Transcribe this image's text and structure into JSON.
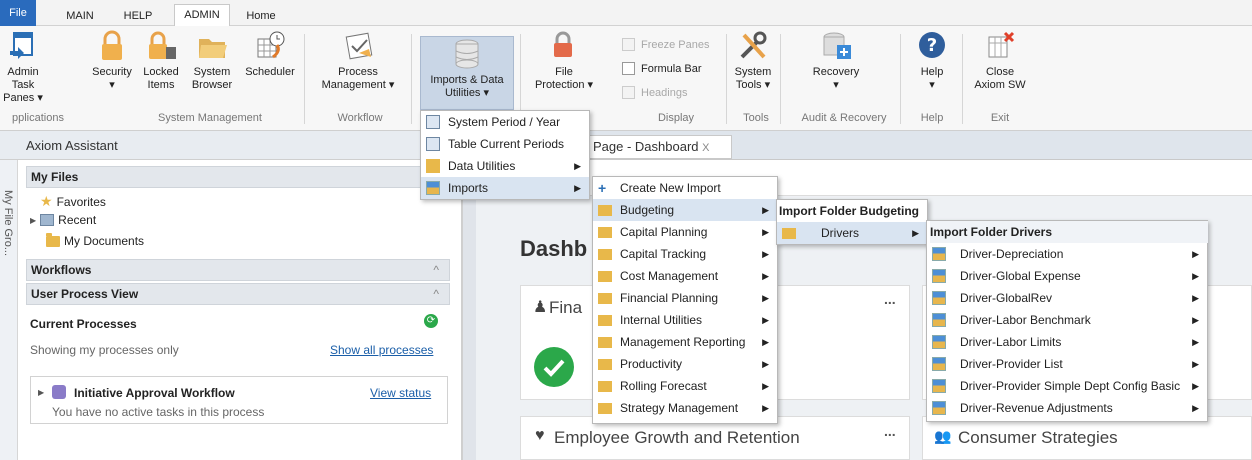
{
  "tabs": [
    "File",
    "MAIN",
    "HELP",
    "ADMIN",
    "Home"
  ],
  "ribbon": {
    "admin_task": [
      "Admin Task",
      "Panes ▾"
    ],
    "security": "Security",
    "locked": [
      "Locked",
      "Items"
    ],
    "system_browser": [
      "System",
      "Browser"
    ],
    "scheduler": "Scheduler",
    "process": [
      "Process",
      "Management ▾"
    ],
    "imports": [
      "Imports & Data",
      "Utilities ▾"
    ],
    "file_protection": [
      "File",
      "Protection ▾"
    ],
    "freeze": "Freeze Panes",
    "formula": "Formula Bar",
    "headings": "Headings",
    "system_tools": [
      "System",
      "Tools ▾"
    ],
    "recovery": "Recovery",
    "help": "Help",
    "close": [
      "Close",
      "Axiom SW"
    ],
    "groups": [
      "pplications",
      "System Management",
      "Workflow",
      "Display",
      "Tools",
      "Audit & Recovery",
      "Help",
      "Exit"
    ]
  },
  "assistant": {
    "title": "Axiom Assistant",
    "my_files": "My Files",
    "favorites": "Favorites",
    "recent": "Recent",
    "my_documents": "My Documents",
    "workflows": "Workflows",
    "user_process_view": "User Process View",
    "current_processes": "Current Processes",
    "showing": "Showing my processes only",
    "show_all": "Show all processes",
    "workflow_name": "Initiative Approval Workflow",
    "view_status": "View status",
    "no_tasks": "You have no active tasks in this process",
    "side_label": "My File Gro..."
  },
  "dashboard": {
    "tab": "Page - Dashboard",
    "tab_close": "X",
    "title": "Dashb",
    "card1": "Fina",
    "card2": "Employee Growth and Retention",
    "card3": "Consumer Strategies",
    "more": "..."
  },
  "menu1": [
    "System Period / Year",
    "Table Current Periods",
    "Data Utilities",
    "Imports"
  ],
  "menu2": [
    "Create New Import",
    "Budgeting",
    "Capital Planning",
    "Capital Tracking",
    "Cost Management",
    "Financial Planning",
    "Internal Utilities",
    "Management Reporting",
    "Productivity",
    "Rolling Forecast",
    "Strategy Management"
  ],
  "menu3": {
    "header": "Import Folder Budgeting",
    "item": "Drivers"
  },
  "menu4": {
    "header": "Import Folder Drivers",
    "items": [
      "Driver-Depreciation",
      "Driver-Global Expense",
      "Driver-GlobalRev",
      "Driver-Labor Benchmark",
      "Driver-Labor Limits",
      "Driver-Provider List",
      "Driver-Provider Simple Dept Config Basic",
      "Driver-Revenue Adjustments"
    ]
  },
  "colors": {
    "file_tab": "#2a6bbd",
    "highlight": "#d9e4f1",
    "green_check": "#2ba84a"
  }
}
